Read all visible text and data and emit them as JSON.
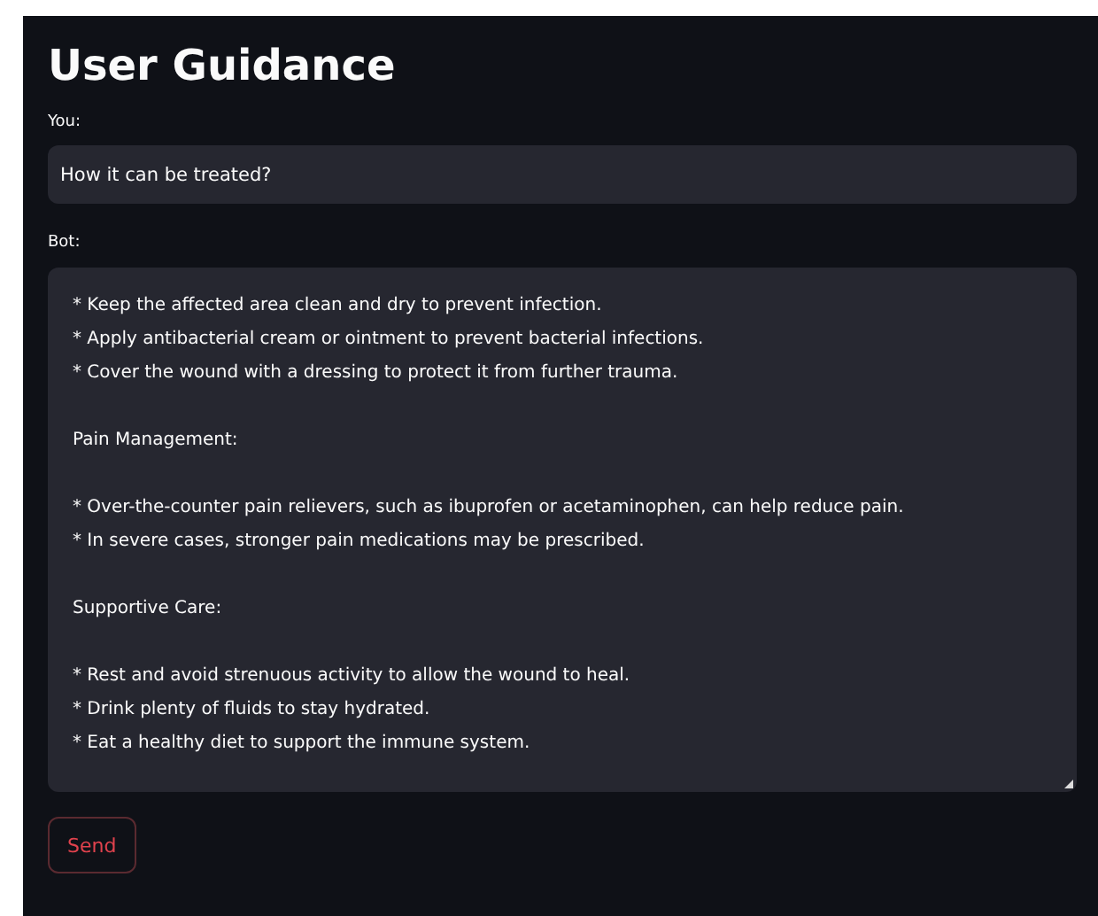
{
  "title": "User Guidance",
  "user_input": {
    "label": "You:",
    "value": "How it can be treated?"
  },
  "bot_output": {
    "label": "Bot:",
    "paragraphs": [
      {
        "lines": [
          "* Keep the affected area clean and dry to prevent infection.",
          "* Apply antibacterial cream or ointment to prevent bacterial infections.",
          "* Cover the wound with a dressing to protect it from further trauma."
        ]
      },
      {
        "lines": [
          "Pain Management:"
        ]
      },
      {
        "lines": [
          "* Over-the-counter pain relievers, such as ibuprofen or acetaminophen, can help reduce pain.",
          "* In severe cases, stronger pain medications may be prescribed."
        ]
      },
      {
        "lines": [
          "Supportive Care:"
        ]
      },
      {
        "lines": [
          "* Rest and avoid strenuous activity to allow the wound to heal.",
          "* Drink plenty of fluids to stay hydrated.",
          "* Eat a healthy diet to support the immune system."
        ]
      }
    ]
  },
  "send_button": "Send"
}
